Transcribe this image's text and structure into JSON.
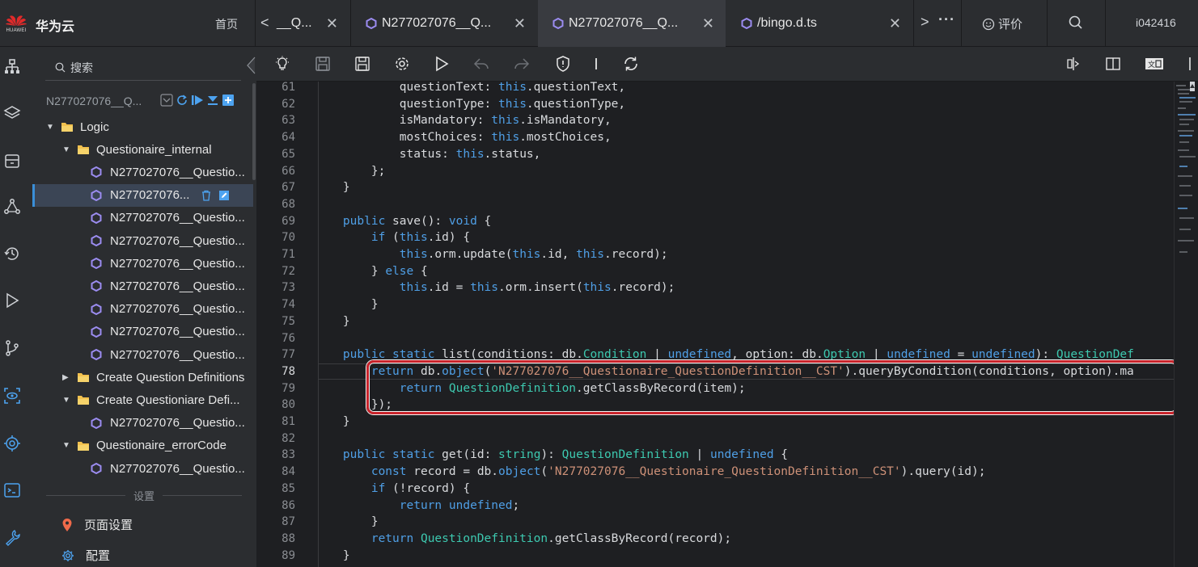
{
  "top_bar": {
    "logo_text": "HUAWEI",
    "app_name": "华为云",
    "home": "首页",
    "tabs": [
      {
        "label": "__Q..."
      },
      {
        "label": "N277027076__Q..."
      },
      {
        "label": "N277027076__Q..."
      },
      {
        "label": "/bingo.d.ts"
      }
    ],
    "rating": "评价",
    "user": "i042416"
  },
  "sidebar": {
    "search_placeholder": "搜索",
    "project_name": "N277027076__Q...",
    "tree": [
      {
        "label": "Logic",
        "kind": "folder",
        "depth": 0,
        "expanded": true
      },
      {
        "label": "Questionaire_internal",
        "kind": "folder",
        "depth": 1,
        "expanded": true
      },
      {
        "label": "N277027076__Questio...",
        "kind": "file",
        "depth": 2
      },
      {
        "label": "N277027076...",
        "kind": "file",
        "depth": 2,
        "selected": true
      },
      {
        "label": "N277027076__Questio...",
        "kind": "file",
        "depth": 2
      },
      {
        "label": "N277027076__Questio...",
        "kind": "file",
        "depth": 2
      },
      {
        "label": "N277027076__Questio...",
        "kind": "file",
        "depth": 2
      },
      {
        "label": "N277027076__Questio...",
        "kind": "file",
        "depth": 2
      },
      {
        "label": "N277027076__Questio...",
        "kind": "file",
        "depth": 2
      },
      {
        "label": "N277027076__Questio...",
        "kind": "file",
        "depth": 2
      },
      {
        "label": "N277027076__Questio...",
        "kind": "file",
        "depth": 2
      },
      {
        "label": "Create Question Definitions",
        "kind": "folder",
        "depth": 1,
        "expanded": false
      },
      {
        "label": "Create Questioniare Defi...",
        "kind": "folder",
        "depth": 1,
        "expanded": true
      },
      {
        "label": "N277027076__Questio...",
        "kind": "file",
        "depth": 2
      },
      {
        "label": "Questionaire_errorCode",
        "kind": "folder",
        "depth": 1,
        "expanded": true
      },
      {
        "label": "N277027076__Questio...",
        "kind": "file",
        "depth": 2
      }
    ],
    "settings_label": "设置",
    "page_settings": "页面设置",
    "config": "配置"
  },
  "editor": {
    "line_numbers": [
      "61",
      "62",
      "63",
      "64",
      "65",
      "66",
      "67",
      "68",
      "69",
      "70",
      "71",
      "72",
      "73",
      "74",
      "75",
      "76",
      "77",
      "78",
      "79",
      "80",
      "81",
      "82",
      "83",
      "84",
      "85",
      "86",
      "87",
      "88",
      "89"
    ],
    "current_line": "78",
    "code": [
      "            questionText: this.questionText,",
      "            questionType: this.questionType,",
      "            isMandatory: this.isMandatory,",
      "            mostChoices: this.mostChoices,",
      "            status: this.status,",
      "        };",
      "    }",
      "",
      "    public save(): void {",
      "        if (this.id) {",
      "            this.orm.update(this.id, this.record);",
      "        } else {",
      "            this.id = this.orm.insert(this.record);",
      "        }",
      "    }",
      "",
      "    public static list(conditions: db.Condition | undefined, option: db.Option | undefined = undefined): QuestionDef",
      "        return db.object('N277027076__Questionaire_QuestionDefinition__CST').queryByCondition(conditions, option).ma",
      "            return QuestionDefinition.getClassByRecord(item);",
      "        });",
      "    }",
      "",
      "    public static get(id: string): QuestionDefinition | undefined {",
      "        const record = db.object('N277027076__Questionaire_QuestionDefinition__CST').query(id);",
      "        if (!record) {",
      "            return undefined;",
      "        }",
      "        return QuestionDefinition.getClassByRecord(record);",
      "    }"
    ]
  },
  "colors": {
    "highlight_box": "#c8232b",
    "keyword": "#4f9fe6",
    "type": "#3dc9b0",
    "string": "#ce9178",
    "accent": "#3a8fd8"
  }
}
